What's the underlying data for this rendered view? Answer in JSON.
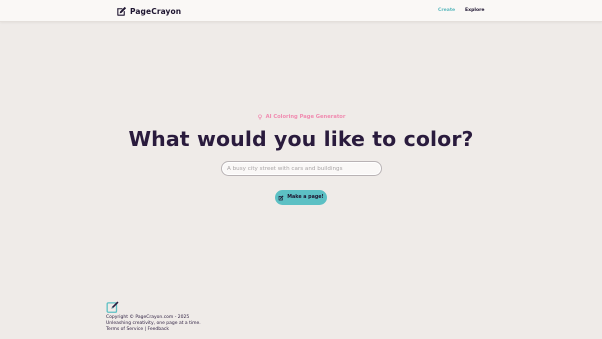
{
  "nav": {
    "brand": "PageCrayon",
    "links": {
      "create": "Create",
      "explore": "Explore"
    }
  },
  "hero": {
    "badge": "AI Coloring Page Generator",
    "title": "What would you like to color?",
    "input_placeholder": "A busy city street with cars and buildings",
    "input_value": "",
    "button_label": "Make a page!"
  },
  "footer": {
    "copyright": "Copyright © PageCrayon.com - 2025",
    "tagline": "Unleashing creativity, one page at a time.",
    "terms": "Terms of Service",
    "separator": "|",
    "feedback": "Feedback"
  },
  "colors": {
    "background": "#efebe8",
    "accent": "#5cc0c4",
    "badge": "#f08bb0",
    "text_dark": "#2a1b3d"
  },
  "icons": {
    "brand": "pencil-square-icon",
    "badge": "lightbulb-icon",
    "button": "pencil-square-icon",
    "footer": "pencil-square-icon"
  }
}
